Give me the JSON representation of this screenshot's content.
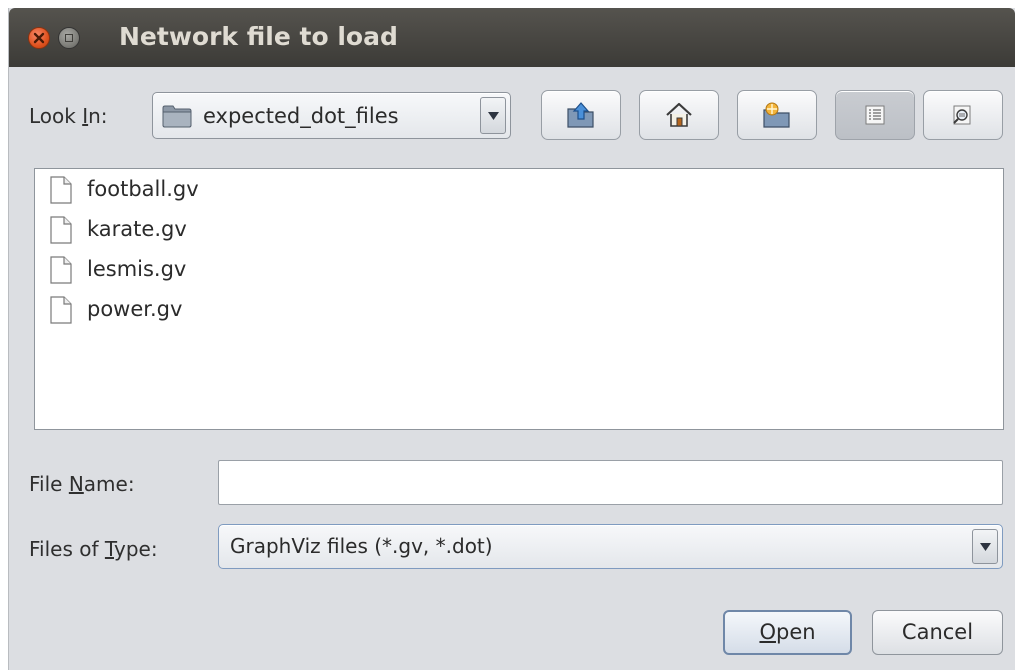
{
  "window": {
    "title": "Network file to load"
  },
  "look_in": {
    "label_pre": "Look ",
    "label_mnemonic": "I",
    "label_post": "n:",
    "value": "expected_dot_files"
  },
  "toolbar": {
    "buttons": [
      {
        "name": "up-one-level",
        "icon": "folder-up-icon"
      },
      {
        "name": "home",
        "icon": "home-icon"
      },
      {
        "name": "create-new-folder",
        "icon": "new-folder-icon"
      },
      {
        "name": "list-view",
        "icon": "list-view-icon",
        "selected": true
      },
      {
        "name": "details-view",
        "icon": "details-view-icon"
      }
    ]
  },
  "files": [
    {
      "name": "football.gv"
    },
    {
      "name": "karate.gv"
    },
    {
      "name": "lesmis.gv"
    },
    {
      "name": "power.gv"
    }
  ],
  "file_name": {
    "label_pre": "File ",
    "label_mnemonic": "N",
    "label_post": "ame:",
    "value": ""
  },
  "file_type": {
    "label_pre": "Files of ",
    "label_mnemonic": "T",
    "label_post": "ype:",
    "value": "GraphViz files (*.gv, *.dot)"
  },
  "actions": {
    "open_mnemonic": "O",
    "open_rest": "pen",
    "cancel_label": "Cancel"
  },
  "colors": {
    "dialog_bg": "#dcdee2",
    "titlebar": "#3c3b37",
    "close_button": "#e0521f",
    "default_border": "#6f87a8"
  }
}
